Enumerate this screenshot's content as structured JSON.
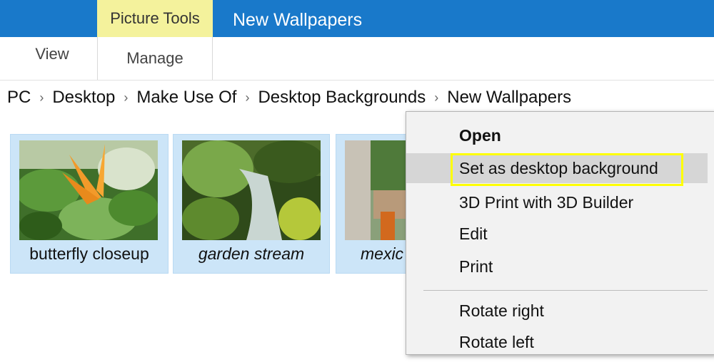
{
  "titlebar": {
    "contextual_group": "Picture Tools",
    "window_title": "New Wallpapers",
    "accent_color": "#1979ca",
    "contextual_color": "#f4f29c"
  },
  "ribbon": {
    "tabs": [
      {
        "label": "View"
      },
      {
        "label": "Manage"
      }
    ]
  },
  "breadcrumb": {
    "items": [
      "PC",
      "Desktop",
      "Make Use Of",
      "Desktop Backgrounds",
      "New Wallpapers"
    ],
    "separator_icon": "chevron-right-icon"
  },
  "files": [
    {
      "name": "butterfly closeup"
    },
    {
      "name": "garden stream"
    },
    {
      "name": "mexic"
    }
  ],
  "context_menu": {
    "items": [
      {
        "label": "Open"
      },
      {
        "label": "Set as desktop background"
      },
      {
        "label": "3D Print with 3D Builder"
      },
      {
        "label": "Edit"
      },
      {
        "label": "Print"
      },
      {
        "label": "Rotate right"
      },
      {
        "label": "Rotate left"
      }
    ],
    "highlight_color": "#ffff00"
  }
}
